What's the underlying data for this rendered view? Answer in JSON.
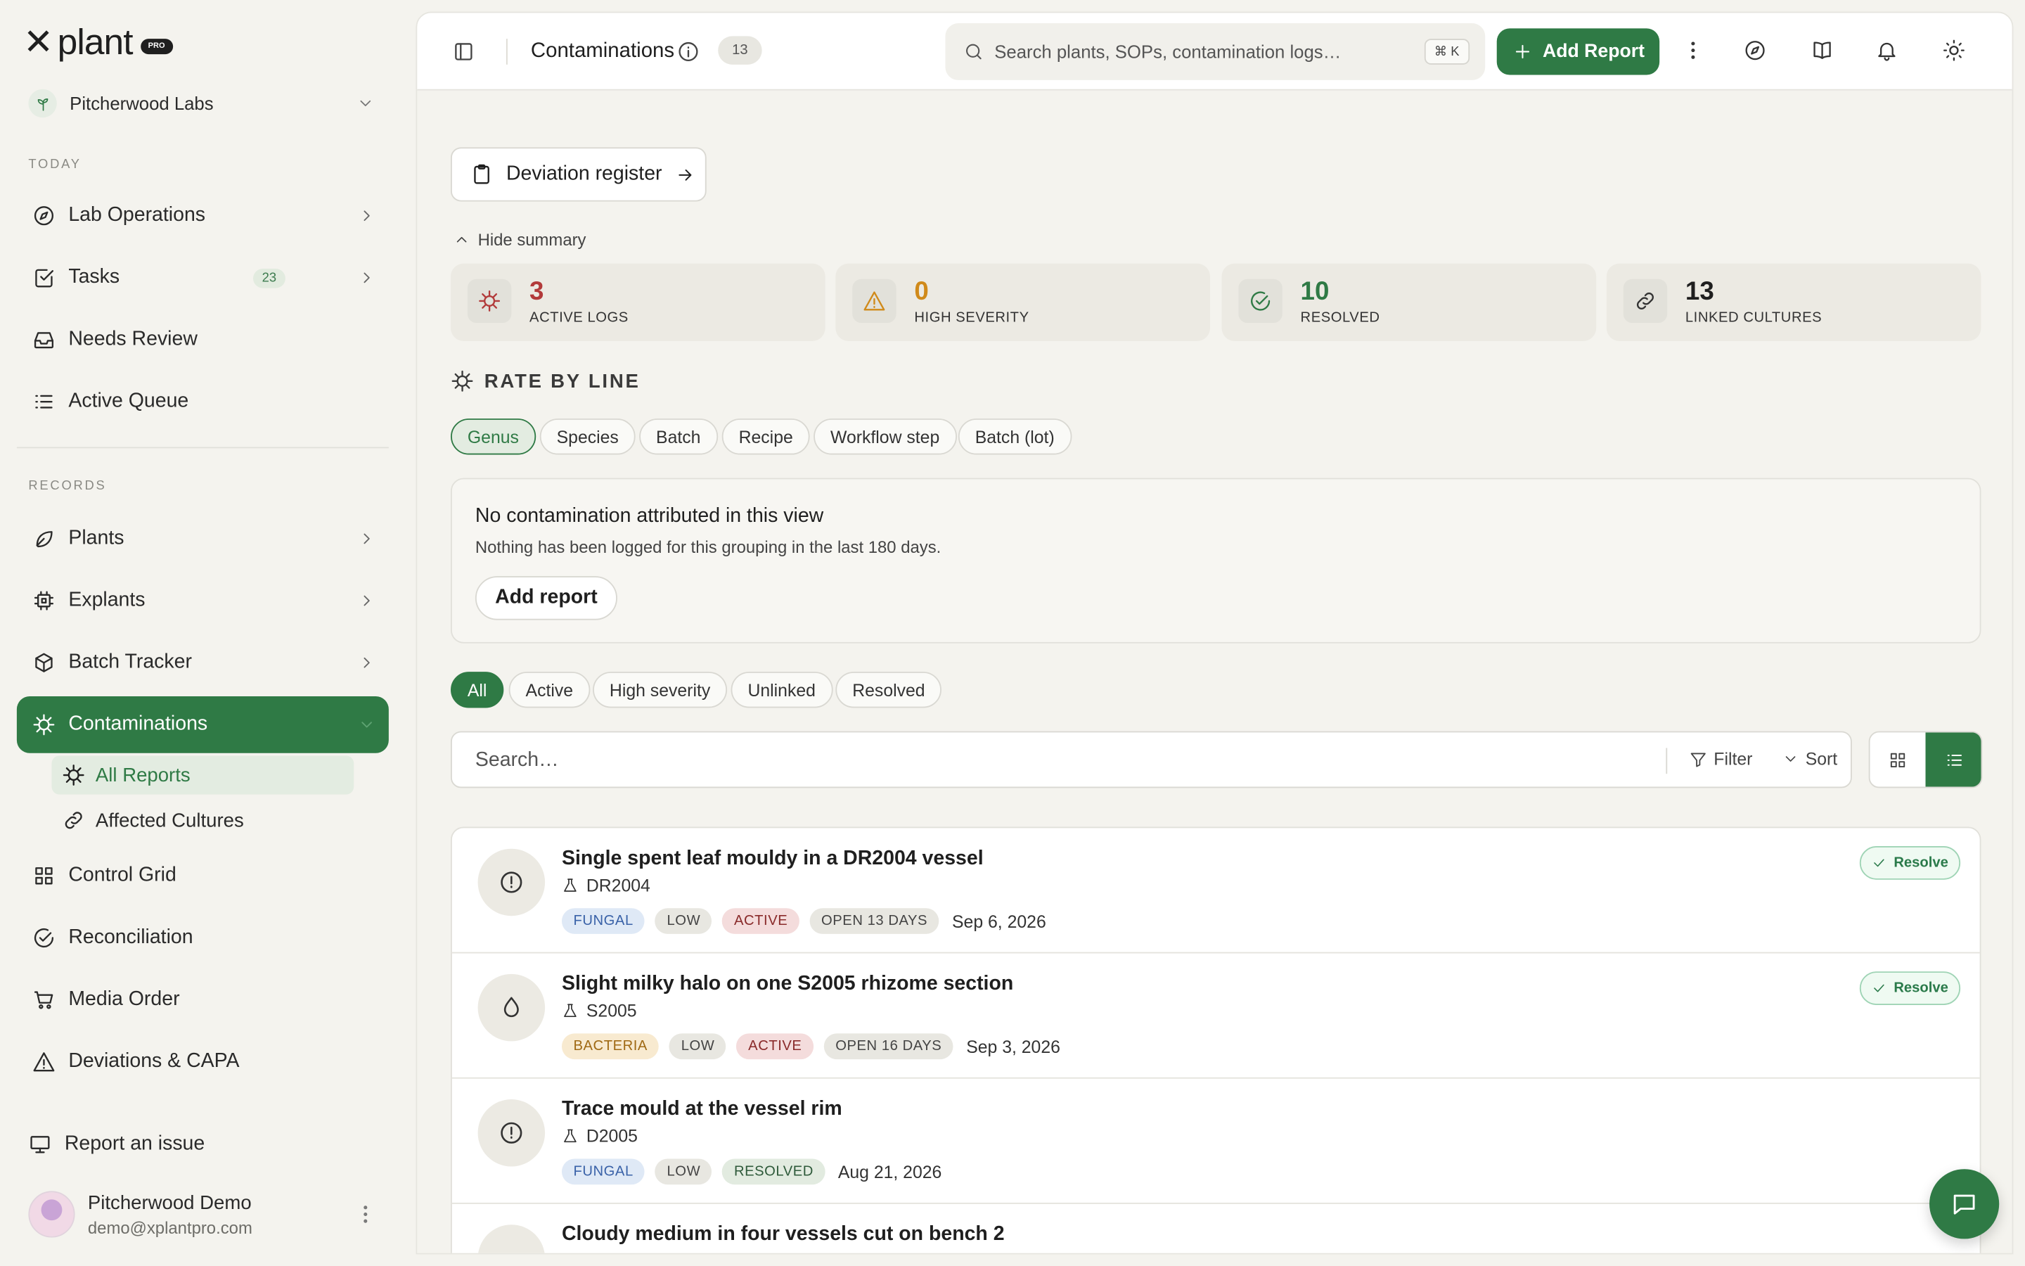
{
  "brand": {
    "name": "plant",
    "badge": "PRO"
  },
  "org": {
    "name": "Pitcherwood Labs"
  },
  "sidebar": {
    "today_label": "TODAY",
    "records_label": "RECORDS",
    "today": [
      {
        "label": "Lab Operations"
      },
      {
        "label": "Tasks",
        "count": "23"
      },
      {
        "label": "Needs Review"
      },
      {
        "label": "Active Queue"
      }
    ],
    "records": [
      {
        "label": "Plants"
      },
      {
        "label": "Explants"
      },
      {
        "label": "Batch Tracker"
      },
      {
        "label": "Contaminations"
      }
    ],
    "contamination_sub": [
      {
        "label": "All Reports"
      },
      {
        "label": "Affected Cultures"
      }
    ],
    "more": [
      {
        "label": "Control Grid"
      },
      {
        "label": "Reconciliation"
      },
      {
        "label": "Media Order"
      },
      {
        "label": "Deviations & CAPA"
      }
    ],
    "report_issue": "Report an issue"
  },
  "user": {
    "name": "Pitcherwood Demo",
    "email": "demo@xplantpro.com"
  },
  "topbar": {
    "title": "Contaminations",
    "count": "13",
    "search_placeholder": "Search plants, SOPs, contamination logs…",
    "shortcut": "⌘ K",
    "add_label": "Add Report"
  },
  "main": {
    "deviation_btn": "Deviation register",
    "hide_summary": "Hide summary",
    "stats": [
      {
        "value": "3",
        "label": "ACTIVE LOGS",
        "color": "#b23a3a"
      },
      {
        "value": "0",
        "label": "HIGH SEVERITY",
        "color": "#d08a1a"
      },
      {
        "value": "10",
        "label": "RESOLVED",
        "color": "#2f7a45"
      },
      {
        "value": "13",
        "label": "LINKED CULTURES",
        "color": "#1f1f1f"
      }
    ],
    "rate_title": "RATE BY LINE",
    "group_chips": [
      "Genus",
      "Species",
      "Batch",
      "Recipe",
      "Workflow step",
      "Batch (lot)"
    ],
    "empty": {
      "title": "No contamination attributed in this view",
      "desc": "Nothing has been logged for this grouping in the last 180 days.",
      "button": "Add report"
    },
    "filter_chips": [
      "All",
      "Active",
      "High severity",
      "Unlinked",
      "Resolved"
    ],
    "search_placeholder": "Search…",
    "filter_label": "Filter",
    "sort_label": "Sort",
    "resolve_label": "Resolve",
    "items": [
      {
        "title": "Single spent leaf mouldy in a DR2004 vessel",
        "code": "DR2004",
        "type": "FUNGAL",
        "severity": "LOW",
        "status": "ACTIVE",
        "open": "OPEN 13 DAYS",
        "date": "Sep 6, 2026"
      },
      {
        "title": "Slight milky halo on one S2005 rhizome section",
        "code": "S2005",
        "type": "BACTERIA",
        "severity": "LOW",
        "status": "ACTIVE",
        "open": "OPEN 16 DAYS",
        "date": "Sep 3, 2026"
      },
      {
        "title": "Trace mould at the vessel rim",
        "code": "D2005",
        "type": "FUNGAL",
        "severity": "LOW",
        "status": "RESOLVED",
        "date": "Aug 21, 2026"
      },
      {
        "title": "Cloudy medium in four vessels cut on bench 2"
      }
    ]
  }
}
